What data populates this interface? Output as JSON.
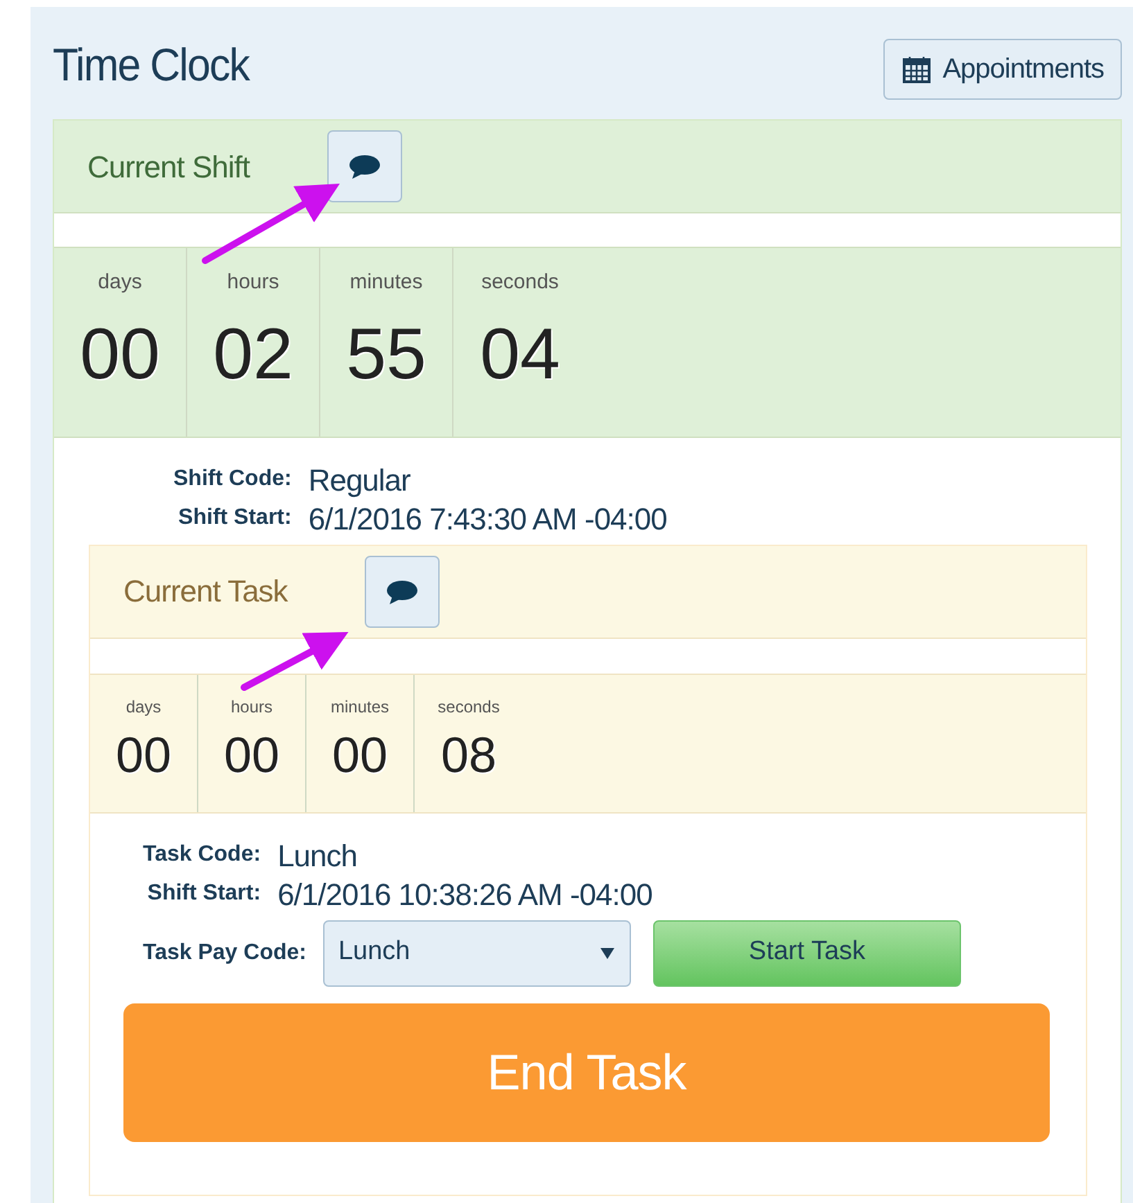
{
  "title": "Time Clock",
  "appointments_button": "Appointments",
  "shift": {
    "title": "Current Shift",
    "timer": [
      {
        "unit": "days",
        "value": "00"
      },
      {
        "unit": "hours",
        "value": "02"
      },
      {
        "unit": "minutes",
        "value": "55"
      },
      {
        "unit": "seconds",
        "value": "04"
      }
    ],
    "details": [
      {
        "label": "Shift Code:",
        "value": "Regular"
      },
      {
        "label": "Shift Start:",
        "value": "6/1/2016 7:43:30 AM -04:00"
      }
    ]
  },
  "task": {
    "title": "Current Task",
    "timer": [
      {
        "unit": "days",
        "value": "00"
      },
      {
        "unit": "hours",
        "value": "00"
      },
      {
        "unit": "minutes",
        "value": "00"
      },
      {
        "unit": "seconds",
        "value": "08"
      }
    ],
    "details": [
      {
        "label": "Task Code:",
        "value": "Lunch"
      },
      {
        "label": "Shift Start:",
        "value": "6/1/2016 10:38:26 AM -04:00"
      }
    ],
    "pay_code": {
      "label": "Task Pay Code:",
      "value": "Lunch"
    },
    "start_button": "Start Task",
    "end_button": "End Task"
  }
}
